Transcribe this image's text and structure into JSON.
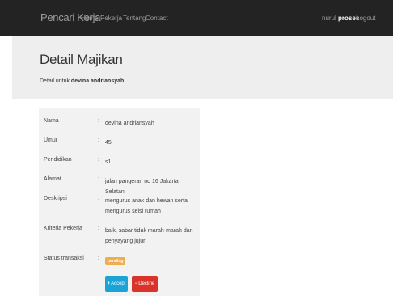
{
  "navbar": {
    "brand": "Pencari Kerja",
    "links": [
      "Home",
      "Pekerja",
      "Tentang",
      "Contact"
    ],
    "user_name": "nurul",
    "user_status": "proses",
    "logout": "Logout"
  },
  "header": {
    "title": "Detail Majikan",
    "subtitle_prefix": "Detail untuk",
    "subtitle_name": "devina andriansyah"
  },
  "details": [
    {
      "label": "Nama",
      "value": "devina andriansyah"
    },
    {
      "label": "Umur",
      "value": "45"
    },
    {
      "label": "Pendidikan",
      "value": "s1"
    },
    {
      "label": "Alamat",
      "value": "jalan pangeran no 16 Jakarta Selatan"
    },
    {
      "label": "Deskripsi",
      "value": "mengurus anak dan hewan serta mengurus seisi rumah"
    },
    {
      "label": "Kriteria Pekerja",
      "value": "baik, sabar tidak marah-marah dan penyayang jujur"
    },
    {
      "label": "Status transaksi",
      "value": "pending"
    }
  ],
  "separator": ":",
  "actions": {
    "accept_icon": "+",
    "accept_label": "Accept",
    "decline_icon": "−",
    "decline_label": "Decline"
  },
  "colors": {
    "navbar": "#232323",
    "accept": "#1ca3d6",
    "decline": "#d9332c",
    "badge": "#f0ad4e"
  }
}
